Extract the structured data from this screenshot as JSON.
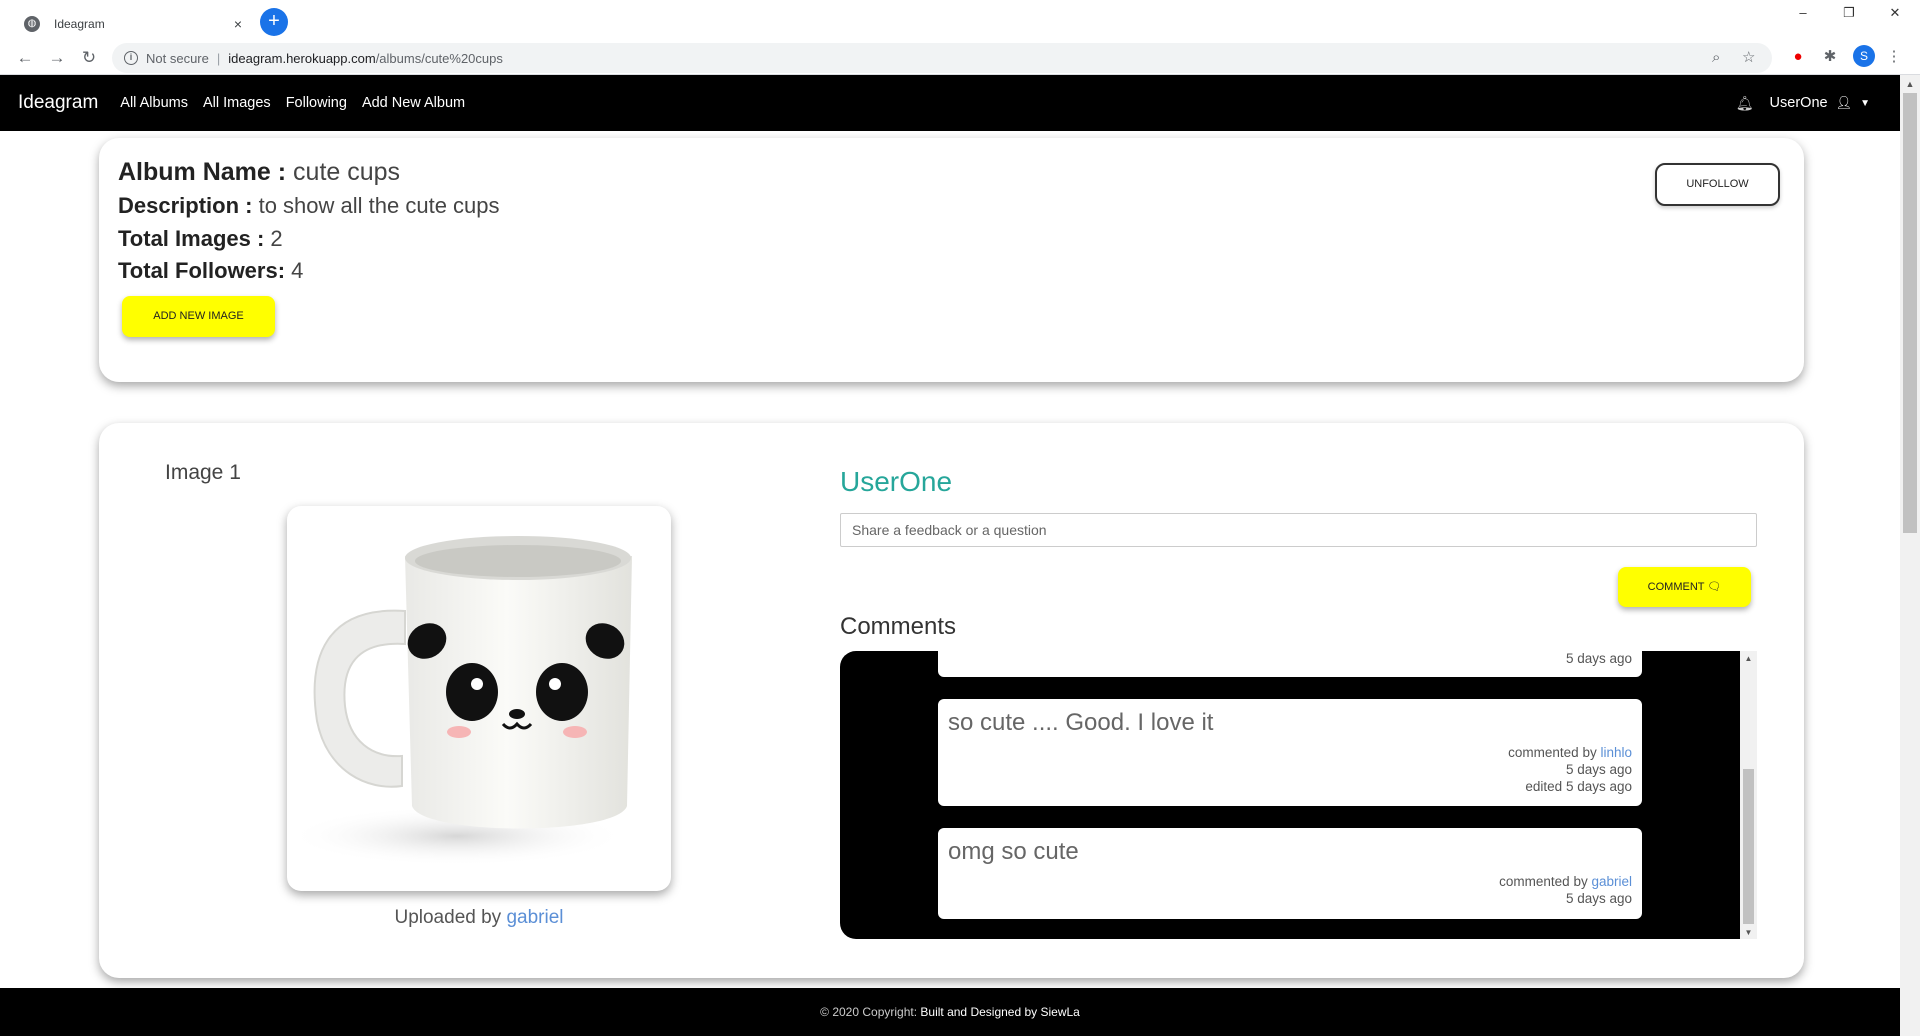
{
  "browser": {
    "tab_title": "Ideagram",
    "tab_close": "×",
    "new_tab": "+",
    "not_secure": "Not secure",
    "url_host": "ideagram.herokuapp.com",
    "url_path": "/albums/cute%20cups",
    "profile_initial": "S",
    "window_minimize": "–",
    "window_restore": "❐",
    "window_close": "✕"
  },
  "navbar": {
    "brand": "Ideagram",
    "links": [
      "All Albums",
      "All Images",
      "Following",
      "Add New Album"
    ],
    "user": "UserOne"
  },
  "album": {
    "name_label": "Album Name :",
    "name": "cute cups",
    "description_label": "Description :",
    "description": "to show all the cute cups",
    "total_images_label": "Total Images :",
    "total_images": "2",
    "total_followers_label": "Total Followers:",
    "total_followers": "4",
    "add_image_button": "ADD NEW IMAGE",
    "unfollow_button": "UNFOLLOW"
  },
  "image": {
    "title": "Image 1",
    "uploaded_by_label": "Uploaded by",
    "uploader": "gabriel"
  },
  "comment_form": {
    "current_user": "UserOne",
    "placeholder": "Share a feedback or a question",
    "button": "COMMENT"
  },
  "comments": {
    "heading": "Comments",
    "items": [
      {
        "text": "",
        "meta1": "5 days ago"
      },
      {
        "text": "so cute .... Good. I love it",
        "by_label": "commented by",
        "author": "linhlo",
        "time": "5 days ago",
        "edited": "edited 5 days ago"
      },
      {
        "text": "omg so cute",
        "by_label": "commented by",
        "author": "gabriel",
        "time": "5 days ago"
      }
    ]
  },
  "footer": {
    "copyright": "© 2020 Copyright:",
    "credit": "Built and Designed by SiewLa"
  },
  "colors": {
    "accent_yellow": "#ffff00",
    "username_teal": "#26a69a",
    "link_blue": "#5b8fd6",
    "navbar_bg": "#000000"
  }
}
